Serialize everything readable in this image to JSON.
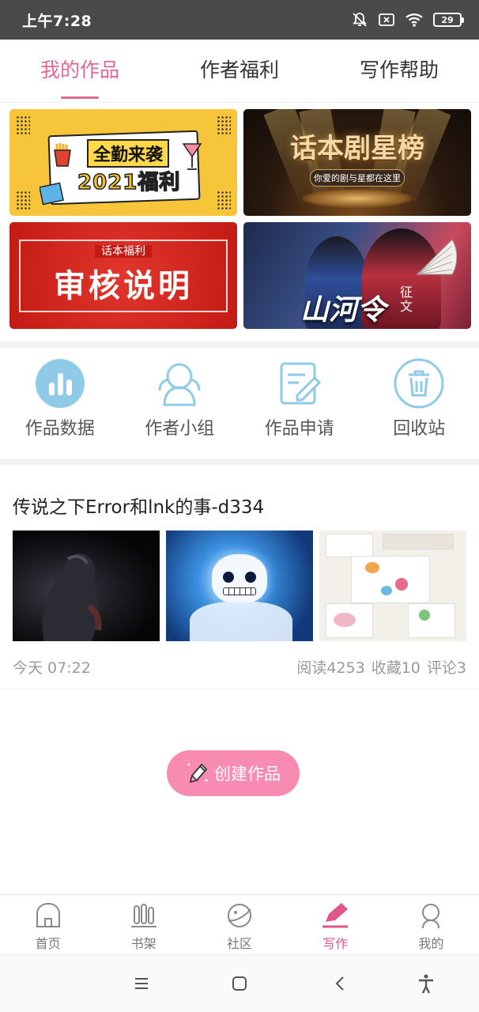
{
  "status_bar": {
    "time": "上午7:28",
    "battery": "29"
  },
  "top_tabs": [
    {
      "label": "我的作品",
      "active": true
    },
    {
      "label": "作者福利",
      "active": false
    },
    {
      "label": "写作帮助",
      "active": false
    }
  ],
  "banners": {
    "welfare": {
      "line1": "全勤来袭",
      "line2": "2021福利"
    },
    "star_board": {
      "title": "话本剧星榜",
      "subtitle": "你爱的剧与星都在这里"
    },
    "review": {
      "small": "话本福利",
      "big": "审核说明"
    },
    "drama": {
      "title": "山河令",
      "tag": "征文"
    }
  },
  "quick_actions": [
    {
      "label": "作品数据",
      "icon": "bar-chart-icon"
    },
    {
      "label": "作者小组",
      "icon": "author-group-icon"
    },
    {
      "label": "作品申请",
      "icon": "edit-document-icon"
    },
    {
      "label": "回收站",
      "icon": "trash-icon"
    }
  ],
  "work": {
    "title": "传说之下Error和lnk的事-d334",
    "time": "今天 07:22",
    "reads": "阅读4253",
    "favorites": "收藏10",
    "comments": "评论3"
  },
  "create_button": {
    "label": "创建作品",
    "icon": "pencil-icon"
  },
  "bottom_nav": [
    {
      "label": "首页",
      "icon": "home-icon",
      "active": false
    },
    {
      "label": "书架",
      "icon": "bookshelf-icon",
      "active": false
    },
    {
      "label": "社区",
      "icon": "planet-icon",
      "active": false
    },
    {
      "label": "写作",
      "icon": "pen-icon",
      "active": true
    },
    {
      "label": "我的",
      "icon": "profile-icon",
      "active": false
    }
  ],
  "colors": {
    "accent": "#e06a8f",
    "create_button": "#f78bb2",
    "quick_icon": "#8fcbe8"
  }
}
